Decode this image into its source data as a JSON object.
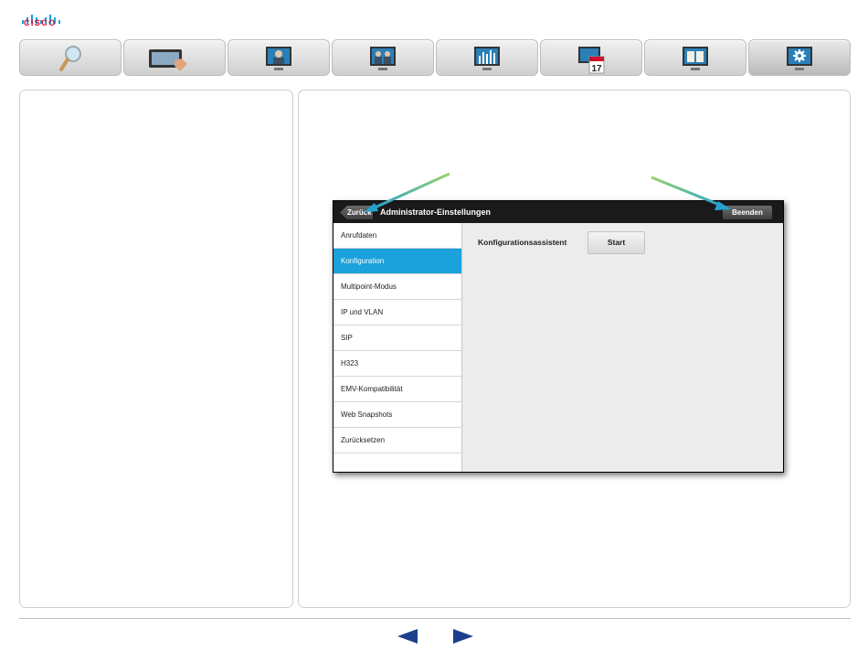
{
  "brand": {
    "name": "CISCO",
    "color": "#d0102c"
  },
  "tabs": [
    {
      "icon": "magnifier-icon"
    },
    {
      "icon": "touch-panel-icon"
    },
    {
      "icon": "video-call-icon"
    },
    {
      "icon": "multi-party-icon"
    },
    {
      "icon": "presentation-icon"
    },
    {
      "icon": "calendar-icon",
      "badge": "17"
    },
    {
      "icon": "book-icon"
    },
    {
      "icon": "settings-icon",
      "active": true
    }
  ],
  "screenshot": {
    "back_label": "Zurück",
    "title": "Administrator-Einstellungen",
    "end_label": "Beenden",
    "menu": [
      {
        "label": "Anrufdaten"
      },
      {
        "label": "Konfiguration",
        "active": true
      },
      {
        "label": "Multipoint-Modus"
      },
      {
        "label": "IP und VLAN"
      },
      {
        "label": "SIP"
      },
      {
        "label": "H323"
      },
      {
        "label": "EMV-Kompatibilität"
      },
      {
        "label": "Web Snapshots"
      },
      {
        "label": "Zurücksetzen"
      }
    ],
    "content_label": "Konfigurationsassistent",
    "start_label": "Start",
    "accent_color": "#1ba1db"
  },
  "footer": {
    "prev_icon": "triangle-left-icon",
    "next_icon": "triangle-right-icon",
    "nav_color": "#1c3f8c"
  }
}
